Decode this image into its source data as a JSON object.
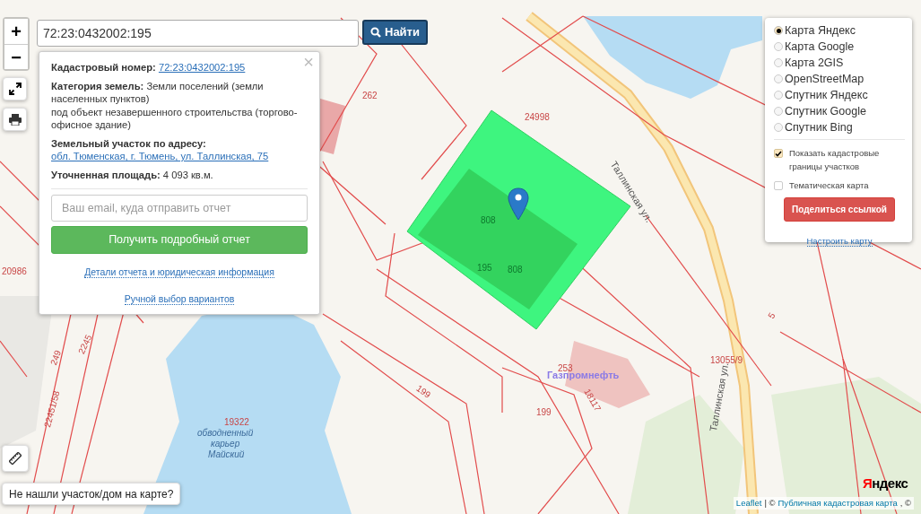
{
  "map_controls": {
    "zoom_in": "+",
    "zoom_out": "−"
  },
  "search": {
    "value": "72:23:0432002:195",
    "button": "Найти"
  },
  "popup": {
    "close": "×",
    "fields": [
      {
        "kind": "link",
        "label": "Кадастровый номер:",
        "value": "72:23:0432002:195"
      },
      {
        "kind": "text",
        "label": "Категория земель:",
        "value": "Земли поселений (земли населенных пунктов)",
        "note": "под объект незавершенного строительства (торгово-офисное здание)"
      },
      {
        "kind": "link",
        "label": "Земельный участок по адресу:",
        "value": "обл. Тюменская, г. Тюмень, ул. Таллинская, 75"
      },
      {
        "kind": "text",
        "label": "Уточненная площадь:",
        "value": "4 093 кв.м."
      }
    ],
    "email_placeholder": "Ваш email, куда отправить отчет",
    "report_button": "Получить подробный отчет",
    "links": [
      "Детали отчета и юридическая информация",
      "Ручной выбор вариантов"
    ]
  },
  "layers": [
    {
      "label": "Карта Яндекс",
      "selected": true
    },
    {
      "label": "Карта Google",
      "selected": false
    },
    {
      "label": "Карта 2GIS",
      "selected": false
    },
    {
      "label": "OpenStreetMap",
      "selected": false
    },
    {
      "label": "Спутник Яндекс",
      "selected": false
    },
    {
      "label": "Спутник Google",
      "selected": false
    },
    {
      "label": "Спутник Bing",
      "selected": false
    }
  ],
  "overlays": [
    {
      "label": "Показать кадастровые границы участков",
      "checked": true
    },
    {
      "label": "Тематическая карта",
      "checked": false
    }
  ],
  "share_button": "Поделиться ссылкой",
  "settings_link": "Настроить карту",
  "not_found_button": "Не нашли участок/дом на карте?",
  "map_labels": [
    {
      "text": "262"
    },
    {
      "text": "24998"
    },
    {
      "text": "Таллинская ул."
    },
    {
      "text": "20986"
    },
    {
      "text": "2245"
    },
    {
      "text": "249"
    },
    {
      "text": "22451/58"
    },
    {
      "text": "19322"
    },
    {
      "text": "обводненный"
    },
    {
      "text": "карьер"
    },
    {
      "text": "Майский"
    },
    {
      "text": "253"
    },
    {
      "text": "Газпромнефть"
    },
    {
      "text": "18117"
    },
    {
      "text": "199"
    },
    {
      "text": "199"
    },
    {
      "text": "13055/9"
    },
    {
      "text": "5"
    },
    {
      "text": "Таллинская ул."
    },
    {
      "text": "808"
    },
    {
      "text": "195"
    },
    {
      "text": "808"
    }
  ],
  "logo": "Яндекс",
  "attribution": [
    {
      "kind": "link",
      "text": "Leaflet"
    },
    {
      "kind": "text",
      "text": "| ©"
    },
    {
      "kind": "link",
      "text": "Публичная кадастровая карта"
    },
    {
      "kind": "text",
      "text": ", ©"
    }
  ]
}
